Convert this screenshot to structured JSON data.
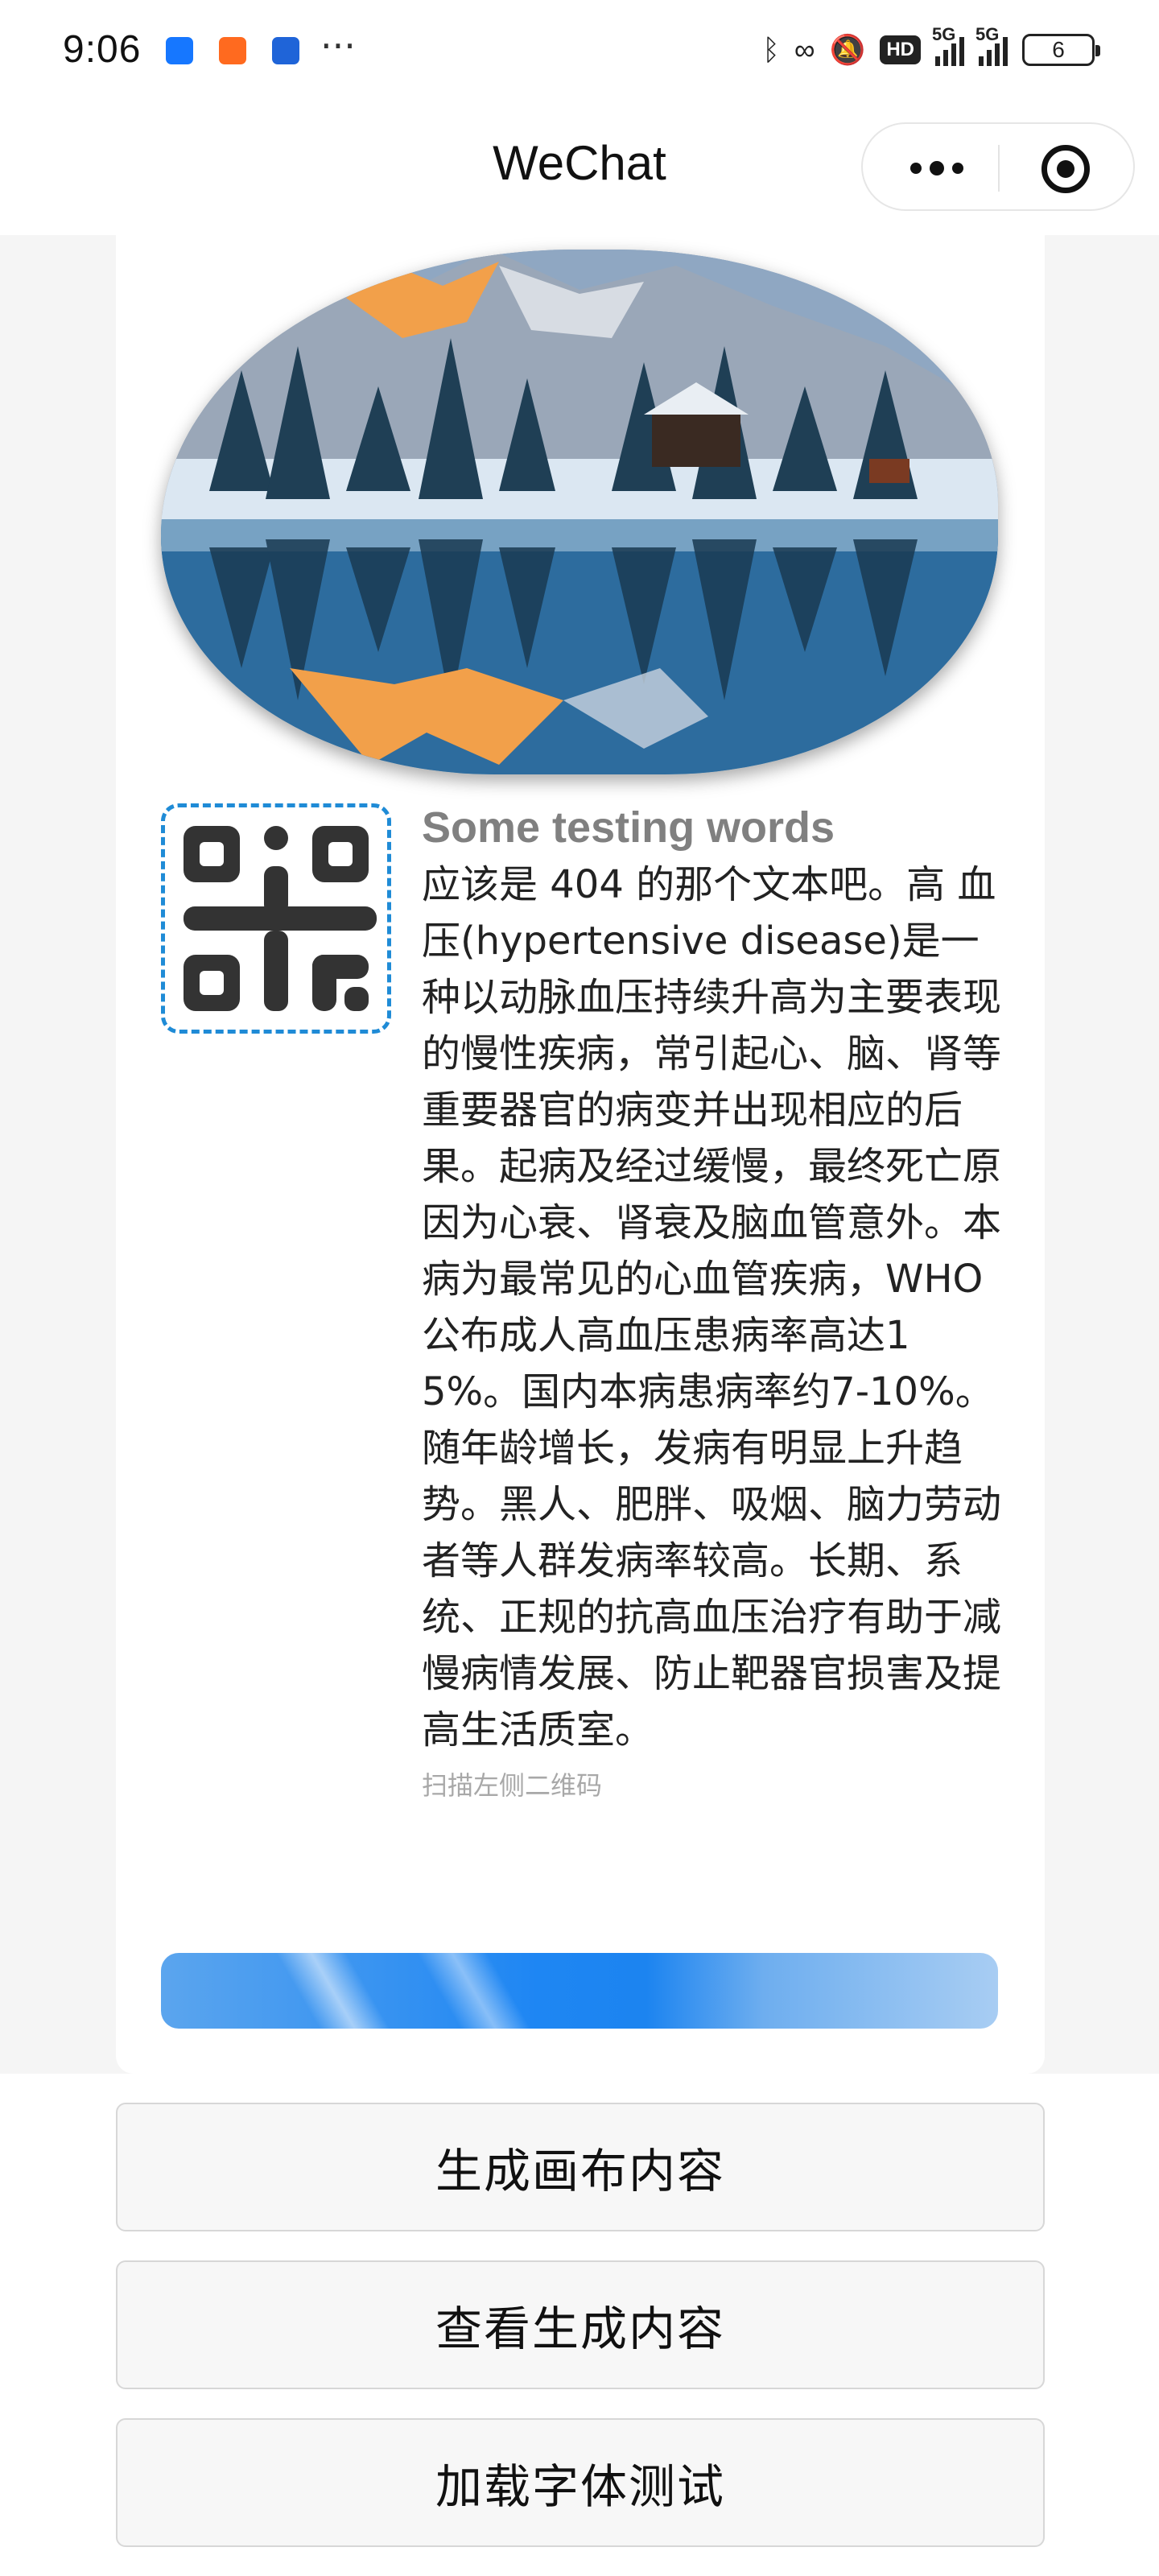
{
  "status_bar": {
    "time": "9:06",
    "notification_icons": [
      "alipay-icon",
      "mi-icon",
      "app-icon"
    ],
    "more": "···",
    "hd_badge": "HD",
    "network_1": "5G",
    "network_2": "5G",
    "battery": "6"
  },
  "nav": {
    "title": "WeChat"
  },
  "content": {
    "heading": "Some testing words",
    "body": "应该是 404 的那个文本吧。高 血压(hypertensive disease)是一种以动脉血压持续升高为主要表现的慢性疾病，常引起心、脑、肾等重要器官的病变并出现相应的后果。起病及经过缓慢，最终死亡原因为心衰、肾衰及脑血管意外。本病为最常见的心血管疾病，WHO公布成人高血压患病率高达15%。国内本病患病率约7-10%。随年龄增长，发病有明显上升趋势。黑人、肥胖、吸烟、脑力劳动者等人群发病率较高。长期、系统、正规的抗高血压治疗有助于减慢病情发展、防止靶器官损害及提高生活质室。",
    "caption": "扫描左侧二维码"
  },
  "buttons": {
    "generate": "生成画布内容",
    "view": "查看生成内容",
    "load_font": "加载字体测试"
  },
  "colors": {
    "qr_border": "#1f8bd6",
    "progress_blue": "#1e86f3",
    "heading_gray": "#808080"
  }
}
